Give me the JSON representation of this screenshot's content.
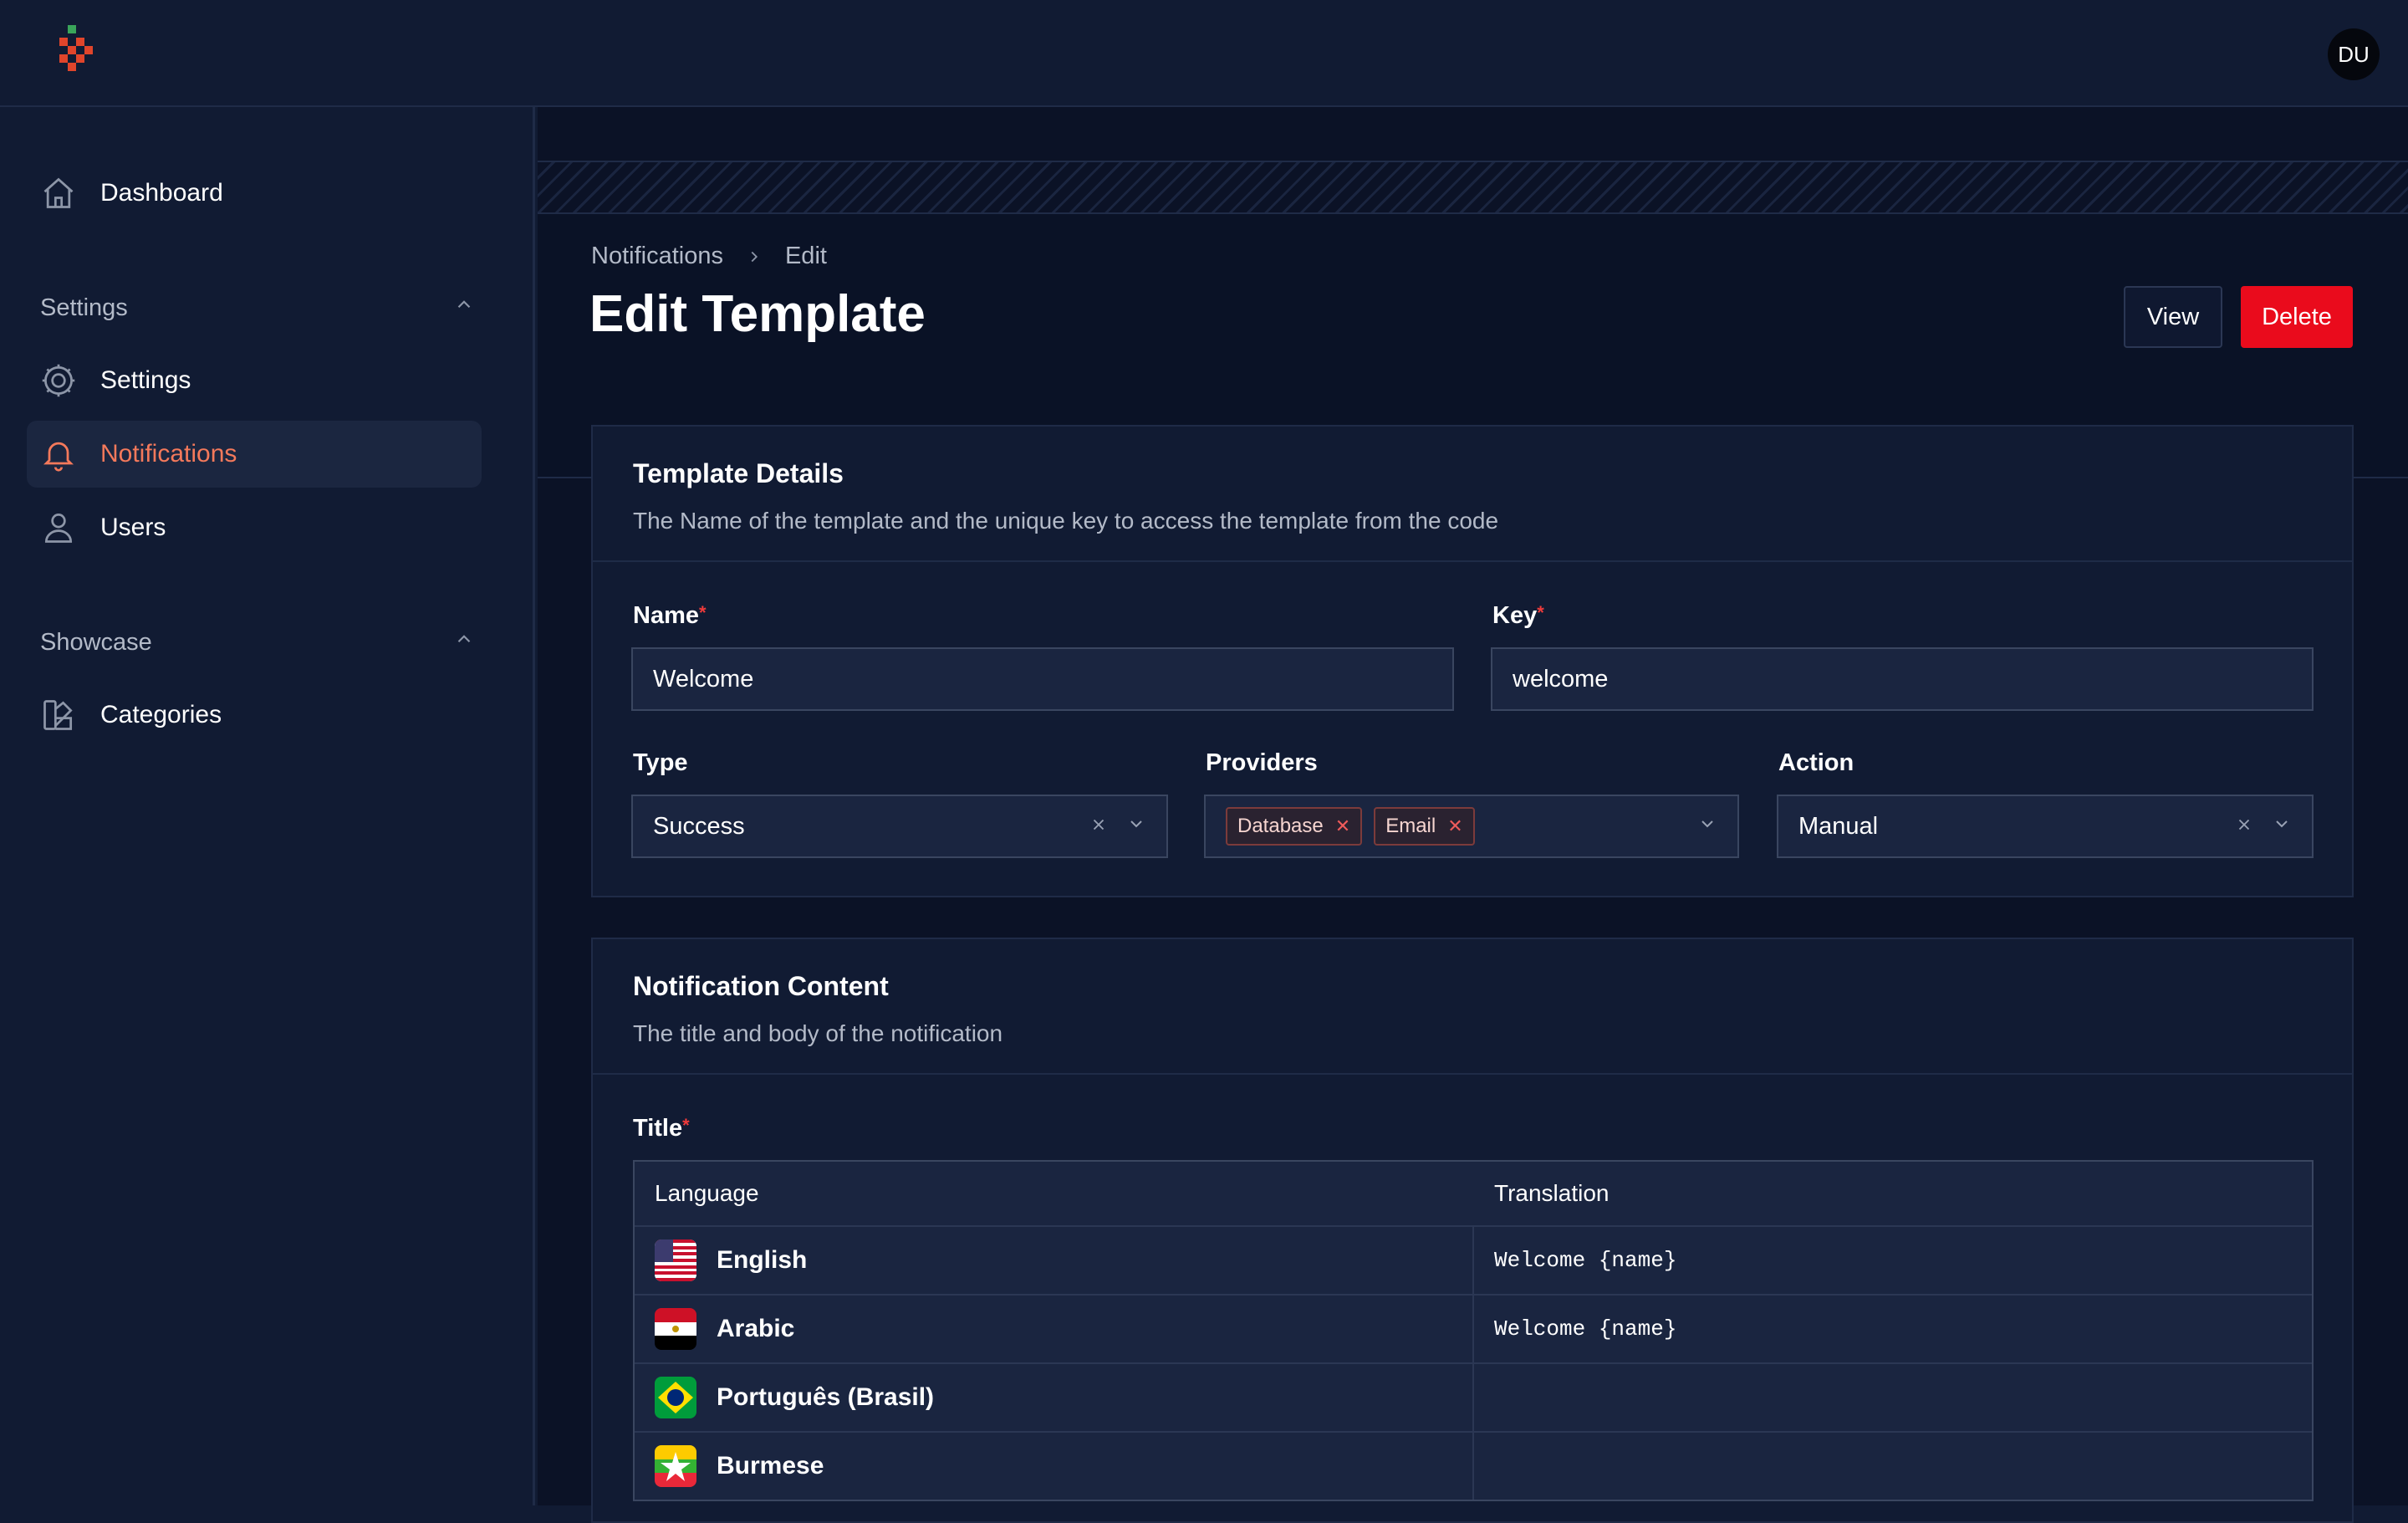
{
  "header": {
    "avatar_initials": "DU"
  },
  "sidebar": {
    "items": [
      {
        "label": "Dashboard",
        "icon": "home-icon"
      },
      {
        "label": "Settings",
        "icon": "gear-icon"
      },
      {
        "label": "Notifications",
        "icon": "bell-icon",
        "active": true
      },
      {
        "label": "Users",
        "icon": "user-icon"
      },
      {
        "label": "Categories",
        "icon": "categories-icon"
      }
    ],
    "groups": [
      {
        "label": "Settings",
        "expanded": true
      },
      {
        "label": "Showcase",
        "expanded": true
      }
    ]
  },
  "breadcrumb": {
    "parent": "Notifications",
    "current": "Edit"
  },
  "page": {
    "title": "Edit Template",
    "view_label": "View",
    "delete_label": "Delete"
  },
  "template_details": {
    "title": "Template Details",
    "description": "The Name of the template and the unique key to access the template from the code",
    "name_label": "Name",
    "name_value": "Welcome",
    "key_label": "Key",
    "key_value": "welcome",
    "type_label": "Type",
    "type_value": "Success",
    "providers_label": "Providers",
    "providers": [
      "Database",
      "Email"
    ],
    "action_label": "Action",
    "action_value": "Manual"
  },
  "notification_content": {
    "title": "Notification Content",
    "description": "The title and body of the notification",
    "title_label": "Title",
    "columns": [
      "Language",
      "Translation"
    ],
    "rows": [
      {
        "language": "English",
        "flag": "us-flag",
        "translation": "Welcome {name}"
      },
      {
        "language": "Arabic",
        "flag": "egypt-flag",
        "translation": "Welcome {name}"
      },
      {
        "language": "Português (Brasil)",
        "flag": "brazil-flag",
        "translation": ""
      },
      {
        "language": "Burmese",
        "flag": "myanmar-flag",
        "translation": ""
      }
    ]
  },
  "colors": {
    "accent": "#f4795b",
    "danger": "#ea0b1c",
    "background": "#111b33",
    "required": "#ef3b3b"
  }
}
